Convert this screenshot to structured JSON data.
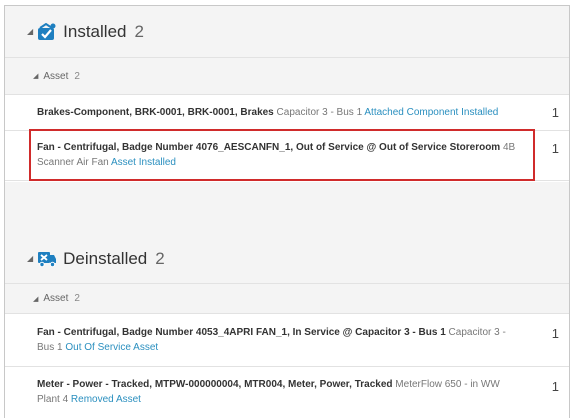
{
  "groups": {
    "installed": {
      "title": "Installed",
      "count": "2",
      "sub": {
        "label": "Asset",
        "count": "2"
      },
      "rows": [
        {
          "name": "Brakes-Component, BRK-0001, BRK-0001, Brakes",
          "desc": "Capacitor 3 - Bus 1",
          "status": "Attached Component Installed",
          "qty": "1"
        },
        {
          "name": "Fan - Centrifugal, Badge Number 4076_AESCANFN_1, Out of Service @ Out of Service Storeroom",
          "desc": "4B Scanner Air Fan",
          "status": "Asset Installed",
          "qty": "1"
        }
      ]
    },
    "deinstalled": {
      "title": "Deinstalled",
      "count": "2",
      "sub": {
        "label": "Asset",
        "count": "2"
      },
      "rows": [
        {
          "name": "Fan - Centrifugal, Badge Number 4053_4APRI FAN_1, In Service @ Capacitor 3 - Bus 1",
          "desc": "Capacitor 3 - Bus 1",
          "status": "Out Of Service Asset",
          "qty": "1"
        },
        {
          "name": "Meter - Power - Tracked, MTPW-000000004, MTR004, Meter, Power, Tracked",
          "desc": "MeterFlow 650 - in WW Plant 4",
          "status": "Removed Asset",
          "qty": "1"
        }
      ]
    }
  },
  "colors": {
    "link": "#2a8fbf",
    "installed_icon": "#1e7fc0",
    "deinstalled_icon": "#1e7fc0",
    "highlight": "#d02b2b"
  },
  "icons": {
    "installed": "installed-check-icon",
    "deinstalled": "deinstalled-truck-icon",
    "expand": "expand-triangle-icon"
  }
}
